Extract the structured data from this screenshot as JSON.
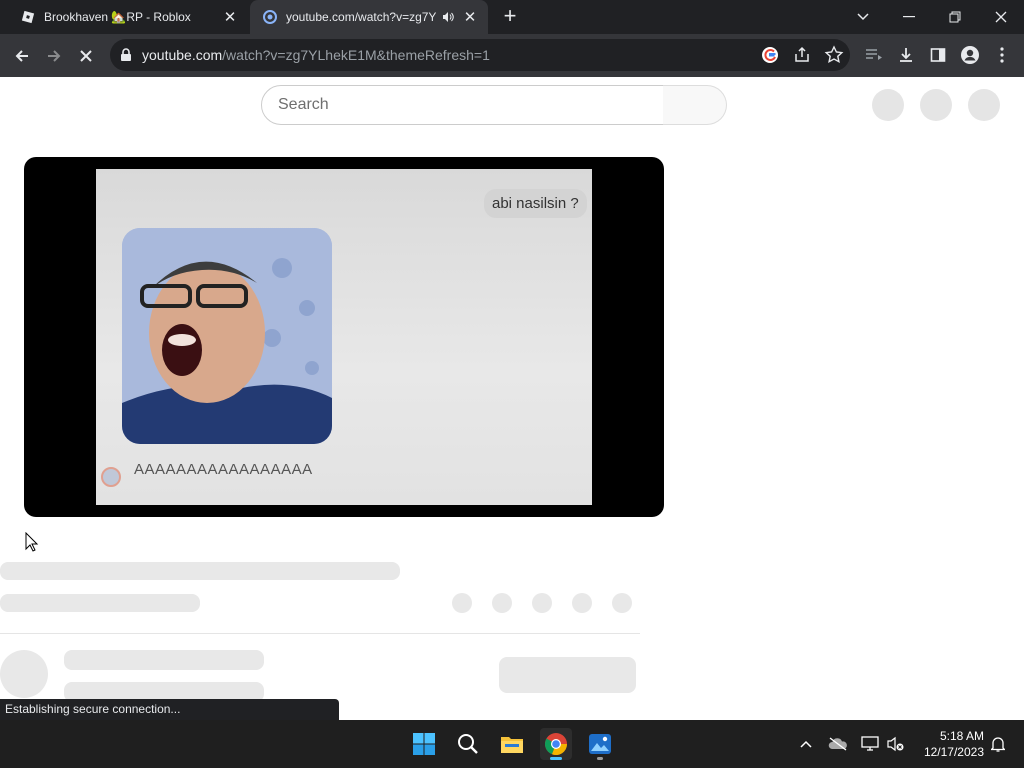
{
  "browser": {
    "tabs": [
      {
        "title": "Brookhaven 🏡RP - Roblox",
        "active": false
      },
      {
        "title": "youtube.com/watch?v=zg7Y",
        "active": true
      }
    ],
    "url_domain": "youtube.com",
    "url_path": "/watch?v=zg7YLhekE1M&themeRefresh=1",
    "status_text": "Establishing secure connection..."
  },
  "page": {
    "search_placeholder": "Search",
    "video": {
      "bubble_text": "abi nasilsin ?",
      "caption_text": "AAAAAAAAAAAAAAAAA"
    }
  },
  "taskbar": {
    "time": "5:18 AM",
    "date": "12/17/2023"
  },
  "colors": {
    "tab_strip": "#202124",
    "toolbar": "#35363a",
    "skeleton": "#e8e8e8"
  }
}
